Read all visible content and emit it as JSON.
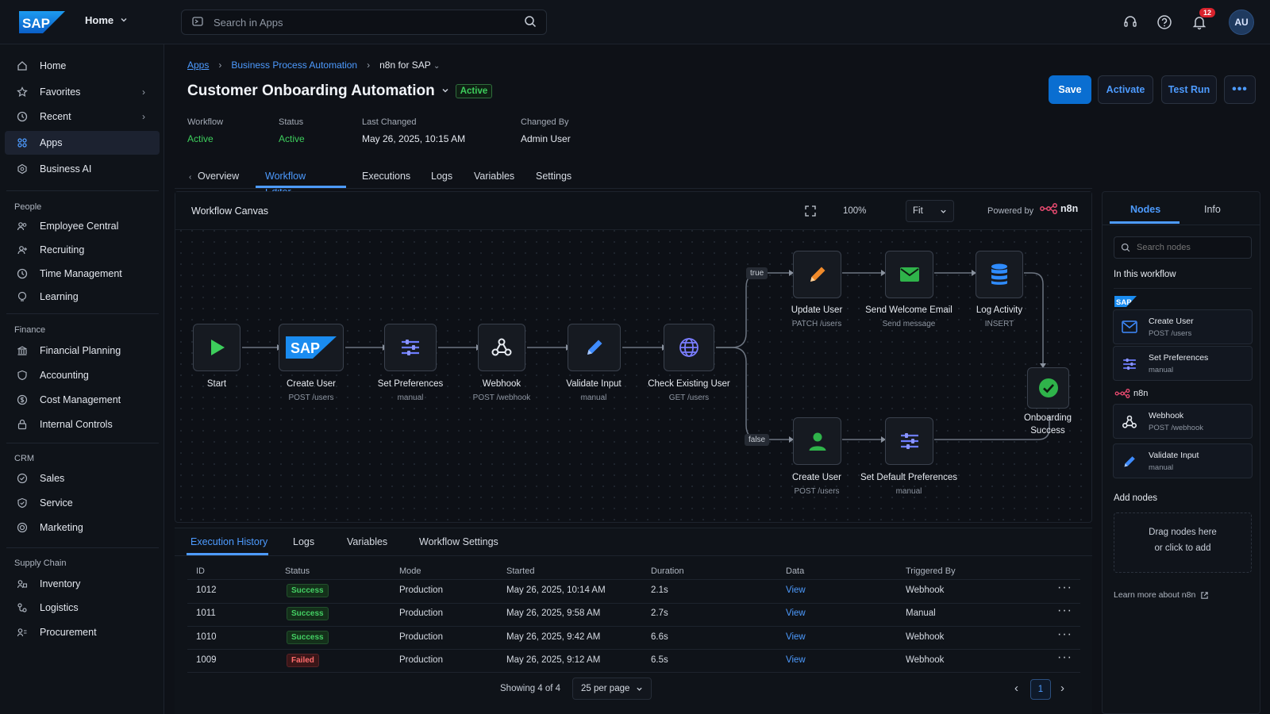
{
  "topbar": {
    "logo_text": "SAP",
    "home_label": "Home",
    "search_placeholder": "Search in Apps",
    "notifications_count": "12",
    "avatar_initials": "AU"
  },
  "sidebar": {
    "top_items": [
      {
        "label": "Home",
        "icon": "home-icon"
      },
      {
        "label": "Favorites",
        "icon": "star-icon",
        "has_chevron": true
      },
      {
        "label": "Recent",
        "icon": "clock-icon",
        "has_chevron": true
      },
      {
        "label": "Apps",
        "icon": "grid-icon",
        "active": true
      },
      {
        "label": "Business AI",
        "icon": "ai-icon"
      }
    ],
    "sections": [
      {
        "title": "People",
        "items": [
          "Employee Central",
          "Recruiting",
          "Time Management",
          "Learning"
        ]
      },
      {
        "title": "Finance",
        "items": [
          "Financial Planning",
          "Accounting",
          "Cost Management",
          "Internal Controls"
        ]
      },
      {
        "title": "CRM",
        "items": [
          "Sales",
          "Service",
          "Marketing"
        ]
      },
      {
        "title": "Supply Chain",
        "items": [
          "Inventory",
          "Logistics",
          "Procurement"
        ]
      }
    ]
  },
  "breadcrumb": {
    "apps": "Apps",
    "bpa": "Business Process Automation",
    "current": "n8n for SAP"
  },
  "header": {
    "title": "Customer Onboarding Automation",
    "status": "Active",
    "buttons": {
      "save": "Save",
      "activate": "Activate",
      "test_run": "Test Run"
    },
    "meta": {
      "workflow_label": "Workflow",
      "workflow_value": "Active",
      "status_label": "Status",
      "status_value": "Active",
      "changed_label": "Last Changed",
      "changed_value": "May 26, 2025, 10:15 AM",
      "changed_by_label": "Changed By",
      "changed_by_value": "Admin User"
    }
  },
  "tabs": [
    "Overview",
    "Workflow Editor",
    "Executions",
    "Logs",
    "Variables",
    "Settings"
  ],
  "canvas": {
    "title": "Workflow Canvas",
    "zoom": "100%",
    "fit": "Fit",
    "powered_by": "Powered by",
    "brand": "n8n",
    "edge_true": "true",
    "edge_false": "false",
    "nodes": {
      "start": {
        "label": "Start",
        "sub": ""
      },
      "create_user": {
        "label": "Create User",
        "sub": "POST /users"
      },
      "set_prefs": {
        "label": "Set Preferences",
        "sub": "manual"
      },
      "webhook": {
        "label": "Webhook",
        "sub": "POST /webhook"
      },
      "validate": {
        "label": "Validate Input",
        "sub": "manual"
      },
      "check": {
        "label": "Check Existing User",
        "sub": "GET /users"
      },
      "update_user": {
        "label": "Update User",
        "sub": "PATCH /users"
      },
      "welcome": {
        "label": "Send Welcome Email",
        "sub": "Send message"
      },
      "log": {
        "label": "Log Activity",
        "sub": "INSERT"
      },
      "success_l1": "Onboarding",
      "success_l2": "Success",
      "create_user2": {
        "label": "Create User",
        "sub": "POST /users"
      },
      "default_prefs": {
        "label": "Set Default Preferences",
        "sub": "manual"
      }
    }
  },
  "right_panel": {
    "tab_nodes": "Nodes",
    "tab_info": "Info",
    "search_placeholder": "Search nodes",
    "in_this_workflow": "In this workflow",
    "group_sap": "SAP",
    "group_n8n": "n8n",
    "items": [
      {
        "title": "Create User",
        "sub": "POST /users",
        "icon": "mail-icon"
      },
      {
        "title": "Set Preferences",
        "sub": "manual",
        "icon": "sliders-icon"
      },
      {
        "title": "Webhook",
        "sub": "POST /webhook",
        "icon": "webhook-icon"
      },
      {
        "title": "Validate Input",
        "sub": "manual",
        "icon": "pencil-icon"
      }
    ],
    "add_nodes": "Add nodes",
    "drag_l1": "Drag nodes here",
    "drag_l2": "or click to add",
    "learn_more": "Learn more about n8n"
  },
  "bottom": {
    "tabs": [
      "Execution History",
      "Logs",
      "Variables",
      "Workflow Settings"
    ],
    "columns": [
      "ID",
      "Status",
      "Mode",
      "Started",
      "Duration",
      "Data",
      "Triggered By"
    ],
    "rows": [
      {
        "id": "1012",
        "status": "Success",
        "mode": "Production",
        "started": "May 26, 2025, 10:14 AM",
        "duration": "2.1s",
        "data": "View",
        "trigger": "Webhook"
      },
      {
        "id": "1011",
        "status": "Success",
        "mode": "Production",
        "started": "May 26, 2025, 9:58 AM",
        "duration": "2.7s",
        "data": "View",
        "trigger": "Manual"
      },
      {
        "id": "1010",
        "status": "Success",
        "mode": "Production",
        "started": "May 26, 2025, 9:42 AM",
        "duration": "6.6s",
        "data": "View",
        "trigger": "Webhook"
      },
      {
        "id": "1009",
        "status": "Failed",
        "mode": "Production",
        "started": "May 26, 2025, 9:12 AM",
        "duration": "6.5s",
        "data": "View",
        "trigger": "Webhook"
      }
    ],
    "showing": "Showing 4 of 4",
    "per_page": "25 per page",
    "page": "1"
  },
  "colors": {
    "accent": "#4d9bff",
    "success": "#3dce5c",
    "failed": "#ff6b6b",
    "brand_sap": "#0a6ed1",
    "n8n": "#ea4b71"
  }
}
